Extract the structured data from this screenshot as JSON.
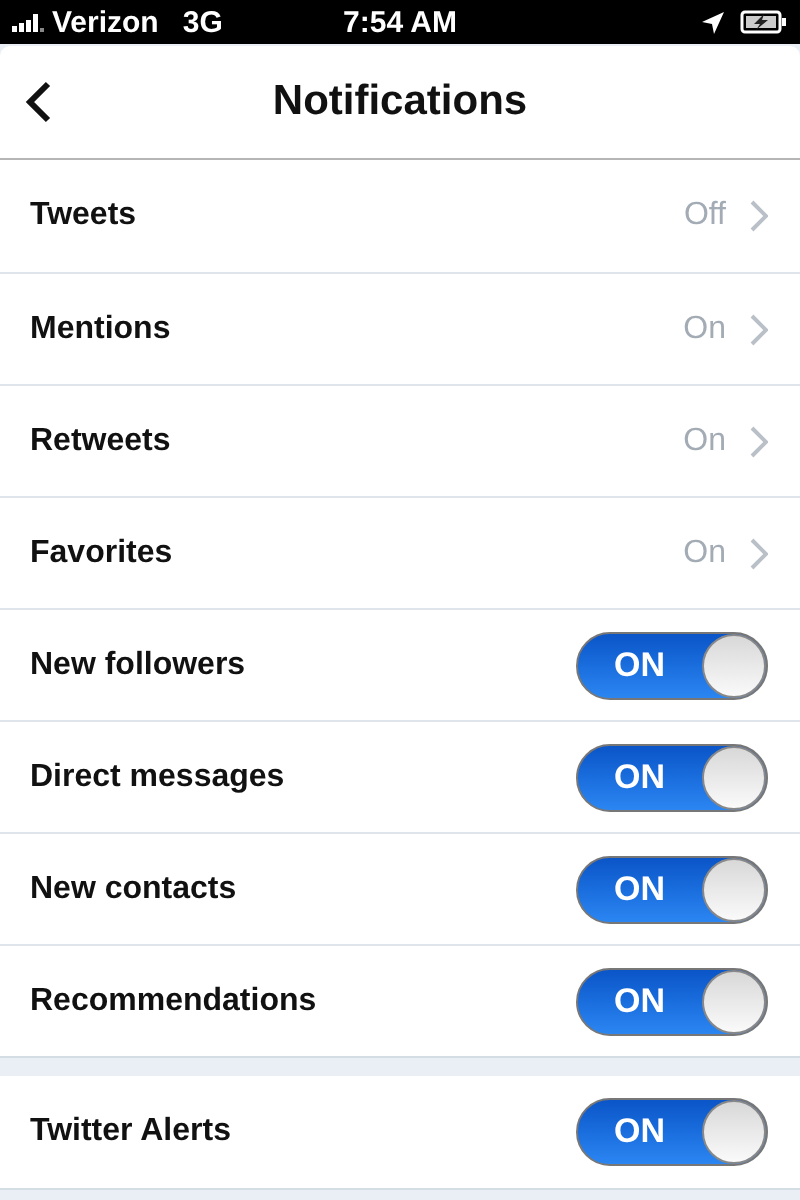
{
  "status_bar": {
    "carrier": "Verizon",
    "network": "3G",
    "time": "7:54 AM"
  },
  "nav": {
    "title": "Notifications"
  },
  "sections": [
    {
      "rows": [
        {
          "kind": "link",
          "label": "Tweets",
          "value": "Off"
        },
        {
          "kind": "link",
          "label": "Mentions",
          "value": "On"
        },
        {
          "kind": "link",
          "label": "Retweets",
          "value": "On"
        },
        {
          "kind": "link",
          "label": "Favorites",
          "value": "On"
        },
        {
          "kind": "switch",
          "label": "New followers",
          "on": true,
          "switch_text": "ON"
        },
        {
          "kind": "switch",
          "label": "Direct messages",
          "on": true,
          "switch_text": "ON"
        },
        {
          "kind": "switch",
          "label": "New contacts",
          "on": true,
          "switch_text": "ON"
        },
        {
          "kind": "switch",
          "label": "Recommendations",
          "on": true,
          "switch_text": "ON"
        }
      ]
    },
    {
      "rows": [
        {
          "kind": "switch",
          "label": "Twitter Alerts",
          "on": true,
          "switch_text": "ON"
        }
      ]
    }
  ]
}
